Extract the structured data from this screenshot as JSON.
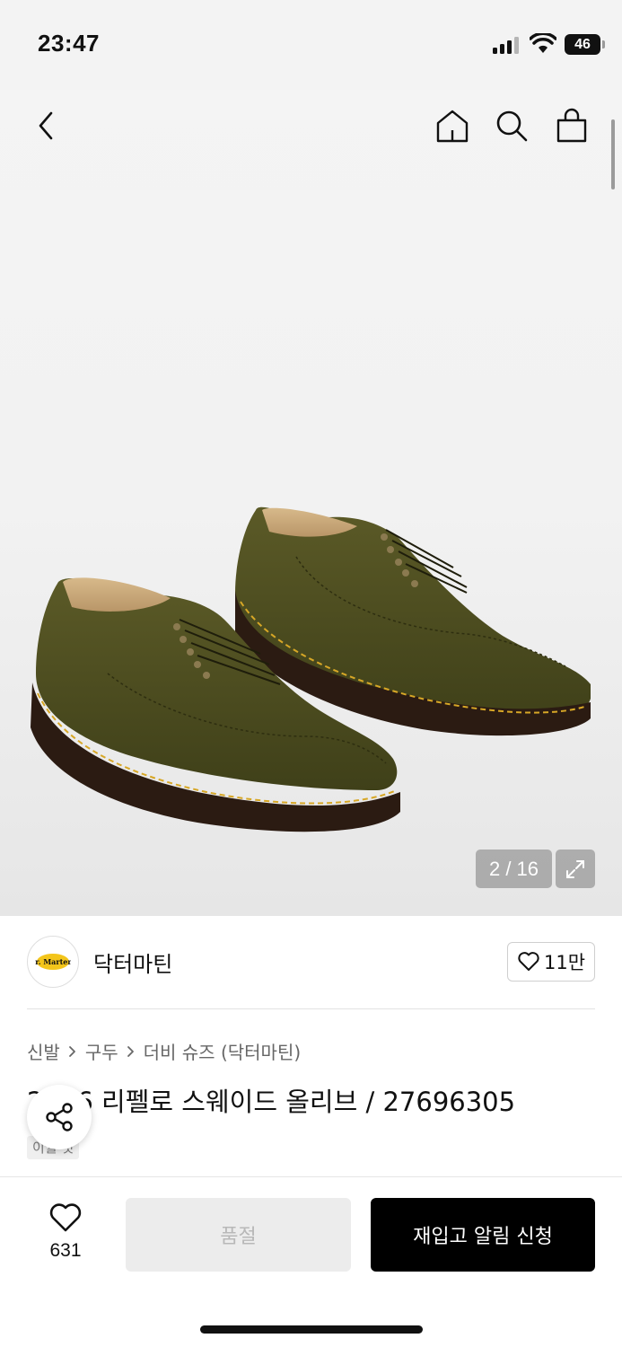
{
  "status_bar": {
    "time": "23:47",
    "battery": "46"
  },
  "header": {
    "icons": [
      "chevron-left-icon",
      "home-icon",
      "search-icon",
      "shopping-bag-icon"
    ]
  },
  "gallery": {
    "counter": "2 / 16",
    "current": 2,
    "total": 16
  },
  "brand": {
    "name": "닥터마틴",
    "logo_text": "Dr. Martens",
    "likes": "11만"
  },
  "breadcrumb": [
    "신발",
    "구두",
    "더비 슈즈 (닥터마틴)"
  ],
  "product": {
    "title": "2046 리펠로 스웨이드 올리브 / 27696305",
    "tag": "이월 것"
  },
  "bottom_bar": {
    "wish_count": "631",
    "soldout_label": "품절",
    "restock_label": "재입고 알림 신청"
  },
  "colors": {
    "accent": "#000000",
    "shoe": "#4a4a1f",
    "sole": "#3a2418",
    "stitch": "#d7a726"
  }
}
